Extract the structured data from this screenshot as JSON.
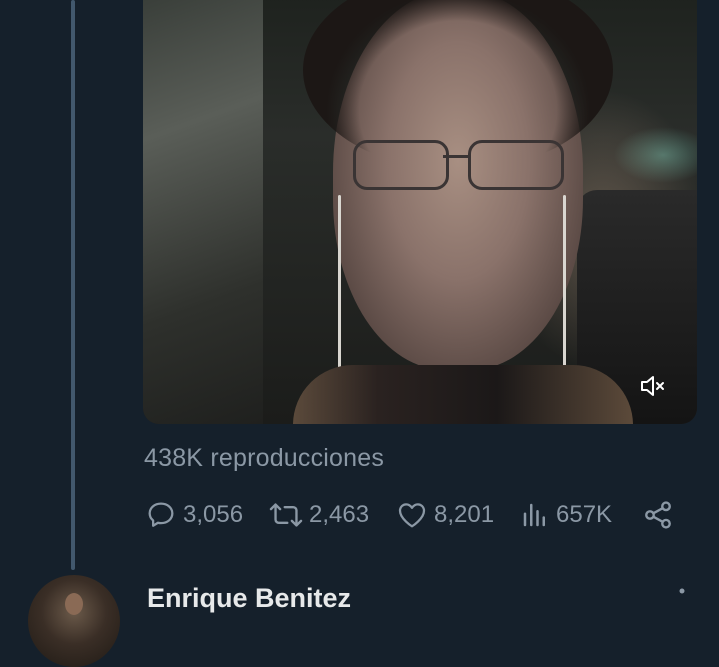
{
  "tweet": {
    "views_text": "438K reproducciones",
    "metrics": {
      "replies": "3,056",
      "retweets": "2,463",
      "likes": "8,201",
      "views": "657K"
    }
  },
  "next_tweet": {
    "author_name": "Enrique Benitez"
  },
  "icons": {
    "reply": "speech-bubble-icon",
    "retweet": "retweet-icon",
    "like": "heart-icon",
    "views": "bar-chart-icon",
    "share": "share-icon",
    "mute": "speaker-muted-icon",
    "more": "more-dots-icon"
  },
  "colors": {
    "background": "#15202b",
    "muted_text": "#8b98a5",
    "primary_text": "#e7e9ea",
    "thread_line": "#42586d"
  }
}
